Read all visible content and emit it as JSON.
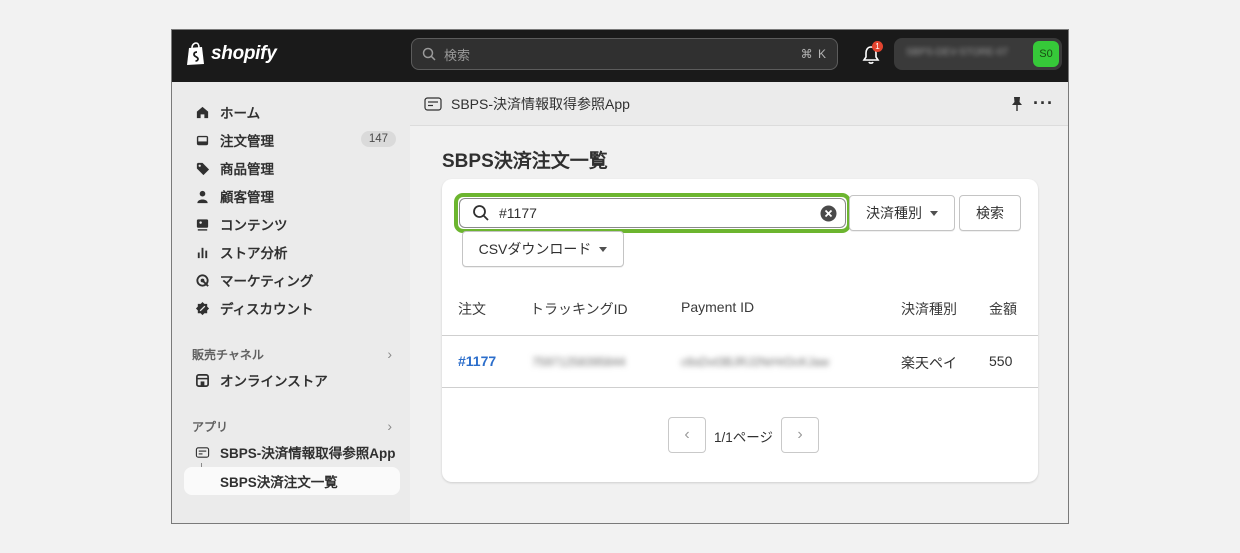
{
  "topbar": {
    "brand": "shopify",
    "search_placeholder": "検索",
    "search_shortcut": "⌘ K",
    "notification_count": "1",
    "store_name": "SBPS-DEV-STORE-07",
    "avatar_initials": "S0"
  },
  "sidebar": {
    "items": [
      {
        "label": "ホーム",
        "icon": "home-icon"
      },
      {
        "label": "注文管理",
        "icon": "inbox-icon",
        "count": "147"
      },
      {
        "label": "商品管理",
        "icon": "tag-icon"
      },
      {
        "label": "顧客管理",
        "icon": "person-icon"
      },
      {
        "label": "コンテンツ",
        "icon": "content-icon"
      },
      {
        "label": "ストア分析",
        "icon": "bar-chart-icon"
      },
      {
        "label": "マーケティング",
        "icon": "target-icon"
      },
      {
        "label": "ディスカウント",
        "icon": "discount-icon"
      }
    ],
    "sales_channels": {
      "heading": "販売チャネル",
      "items": [
        {
          "label": "オンラインストア",
          "icon": "store-icon"
        }
      ]
    },
    "apps": {
      "heading": "アプリ",
      "app_label": "SBPS-決済情報取得参照App",
      "sub_label": "SBPS決済注文一覧"
    }
  },
  "main": {
    "app_title": "SBPS-決済情報取得参照App",
    "page_title": "SBPS決済注文一覧",
    "filter_value": "#1177",
    "payment_type_button": "決済種別",
    "search_button": "検索",
    "csv_button": "CSVダウンロード",
    "table": {
      "headers": [
        "注文",
        "トラッキングID",
        "Payment ID",
        "決済種別",
        "金額"
      ],
      "rows": [
        {
          "order": "#1177",
          "tracking_id": "75971258395844",
          "payment_id": "c6sDvt3BJRJ2NrHrDcKJaw",
          "payment_type": "楽天ペイ",
          "amount": "550"
        }
      ]
    },
    "pagination": {
      "label": "1/1ページ"
    }
  },
  "colors": {
    "accent_green": "#6cb52f",
    "link_blue": "#2c6ecb",
    "avatar_green": "#36c939"
  }
}
